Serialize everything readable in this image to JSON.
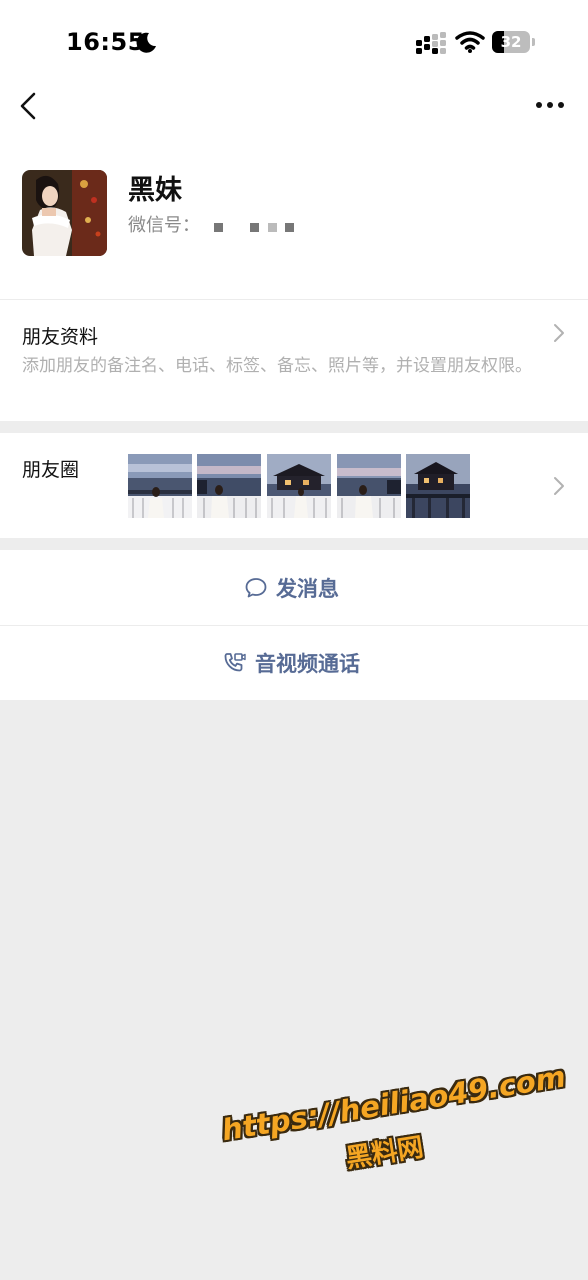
{
  "status_bar": {
    "time": "16:55",
    "battery_level": 32,
    "battery_text": "32",
    "icons": [
      "moon-icon",
      "signal-icon",
      "wifi-icon",
      "battery-icon"
    ]
  },
  "nav": {
    "back_icon": "chevron-left-icon",
    "more_icon": "more-dots-icon"
  },
  "profile": {
    "name": "黑妹",
    "wechat_id_label": "微信号："
  },
  "friend_info": {
    "title": "朋友资料",
    "description": "添加朋友的备注名、电话、标签、备忘、照片等，并设置朋友权限。"
  },
  "moments": {
    "title": "朋友圈",
    "photo_count": 5
  },
  "actions": {
    "message_label": "发消息",
    "message_icon": "chat-bubble-icon",
    "call_label": "音视频通话",
    "call_icon": "phone-video-icon"
  },
  "watermark": {
    "url": "https://heiliao49.com",
    "site": "黑料网"
  },
  "colors": {
    "link_blue": "#576b95",
    "background_gray": "#ededed",
    "watermark_orange": "#f5a623"
  }
}
